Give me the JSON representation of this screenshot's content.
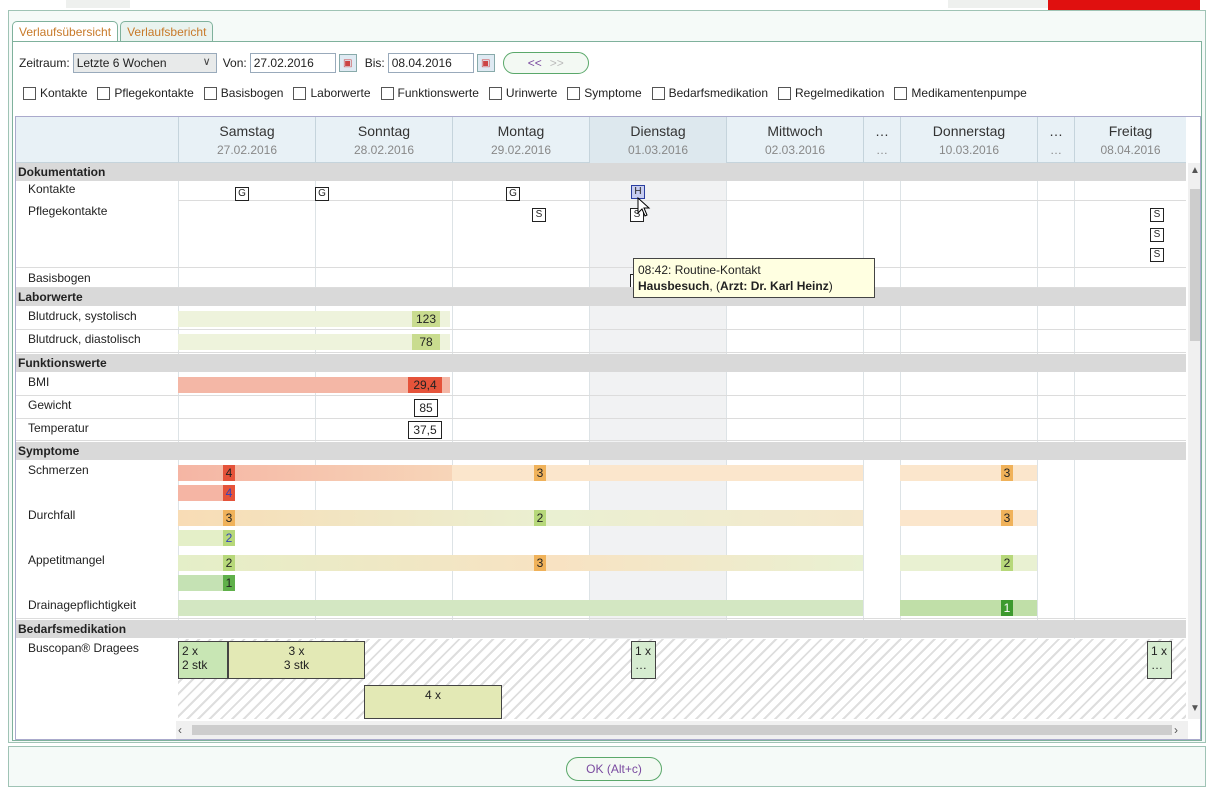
{
  "tabs": [
    "Verlaufsübersicht",
    "Verlaufsbericht"
  ],
  "toolbar": {
    "zeitraum_label": "Zeitraum:",
    "zeitraum_value": "Letzte 6 Wochen",
    "von_label": "Von:",
    "von_value": "27.02.2016",
    "bis_label": "Bis:",
    "bis_value": "08.04.2016",
    "prev": "<<",
    "next": ">>"
  },
  "filters": [
    "Kontakte",
    "Pflegekontakte",
    "Basisbogen",
    "Laborwerte",
    "Funktionswerte",
    "Urinwerte",
    "Symptome",
    "Bedarfsmedikation",
    "Regelmedikation",
    "Medikamentenpumpe"
  ],
  "columns": [
    {
      "day": "Samstag",
      "date": "27.02.2016"
    },
    {
      "day": "Sonntag",
      "date": "28.02.2016"
    },
    {
      "day": "Montag",
      "date": "29.02.2016"
    },
    {
      "day": "Dienstag",
      "date": "01.03.2016"
    },
    {
      "day": "Mittwoch",
      "date": "02.03.2016"
    },
    {
      "day": "…",
      "date": "…"
    },
    {
      "day": "Donnerstag",
      "date": "10.03.2016"
    },
    {
      "day": "…",
      "date": "…"
    },
    {
      "day": "Freitag",
      "date": "08.04.2016"
    }
  ],
  "sections": {
    "dokumentation": "Dokumentation",
    "laborwerte": "Laborwerte",
    "funktionswerte": "Funktionswerte",
    "symptome": "Symptome",
    "bedarfsmedikation": "Bedarfsmedikation"
  },
  "rows": {
    "kontakte": "Kontakte",
    "pflegekontakte": "Pflegekontakte",
    "basisbogen": "Basisbogen",
    "bp_sys": "Blutdruck, systolisch",
    "bp_dia": "Blutdruck, diastolisch",
    "bmi": "BMI",
    "gewicht": "Gewicht",
    "temperatur": "Temperatur",
    "schmerzen": "Schmerzen",
    "durchfall": "Durchfall",
    "appetitmangel": "Appetitmangel",
    "drainage": "Drainagepflichtigkeit",
    "buscopan": "Buscopan® Dragees"
  },
  "marks": {
    "g": "G",
    "h": "H",
    "s": "S"
  },
  "values": {
    "bp_sys": "123",
    "bp_dia": "78",
    "bmi": "29,4",
    "gewicht": "85",
    "temperatur": "37,5",
    "schmerzen": [
      "4",
      "4",
      "3",
      "3"
    ],
    "durchfall": [
      "3",
      "2",
      "3",
      "2"
    ],
    "appetit": [
      "2",
      "1",
      "3",
      "2"
    ],
    "drainage": "1"
  },
  "medication": {
    "m1a": "2 x",
    "m1b": "2 stk",
    "m2a": "3 x",
    "m2b": "3 stk",
    "m3a": "4 x",
    "m4a": "1 x",
    "m4b": "…",
    "m5a": "1 x",
    "m5b": "…"
  },
  "tooltip": {
    "line1": "08:42: Routine-Kontakt",
    "line2_bold": "Hausbesuch",
    "line2_rest": ", (",
    "line2_bold2": "Arzt: Dr. Karl Heinz",
    "line2_end": ")"
  },
  "ok_button": "OK (Alt+c)",
  "colors": {
    "pain_high": "#e5533a",
    "pain_mid": "#f0b25a",
    "mild": "#b7d87a",
    "low": "#5fb04a"
  }
}
